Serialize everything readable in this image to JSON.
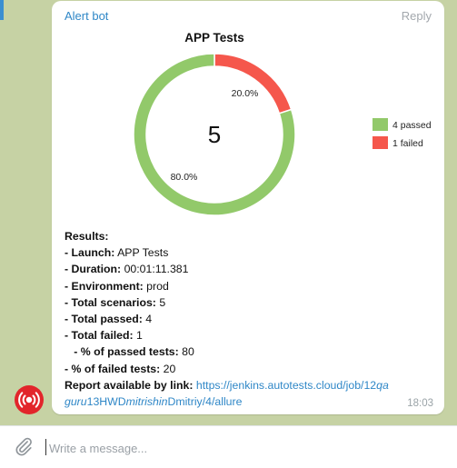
{
  "message": {
    "sender": "Alert bot",
    "reply_label": "Reply",
    "time": "18:03",
    "results": {
      "heading": "Results:",
      "launch_label": " - Launch:",
      "launch_value": " APP Tests",
      "duration_label": " - Duration:",
      "duration_value": " 00:01:11.381",
      "environment_label": " - Environment:",
      "environment_value": " prod",
      "scenarios_label": " - Total scenarios:",
      "scenarios_value": " 5",
      "passed_label": " - Total passed:",
      "passed_value": " 4",
      "failed_label": " - Total failed:",
      "failed_value": " 1",
      "pct_passed_label": "   - % of passed tests:",
      "pct_passed_value": " 80",
      "pct_failed_label": " - % of failed tests:",
      "pct_failed_value": " 20",
      "report_label": " Report available by link:",
      "link_part1": "https://jenkins.autotests.cloud/job/12",
      "link_part2": "qa",
      "link_part3": "guru",
      "link_part4": "13HWD",
      "link_part5": "mitrishin",
      "link_part6": "Dmitriy/4/allure"
    }
  },
  "chart_data": {
    "type": "pie",
    "title": "APP Tests",
    "center_label": "5",
    "slices": [
      {
        "name": "4 passed",
        "value": 80.0,
        "label": "80.0%",
        "color": "#92c96a"
      },
      {
        "name": "1 failed",
        "value": 20.0,
        "label": "20.0%",
        "color": "#f5574c"
      }
    ],
    "legend_position": "right"
  },
  "composer": {
    "placeholder": "Write a message..."
  },
  "icons": {
    "attach": "paperclip-icon",
    "avatar": "broadcast-icon"
  }
}
